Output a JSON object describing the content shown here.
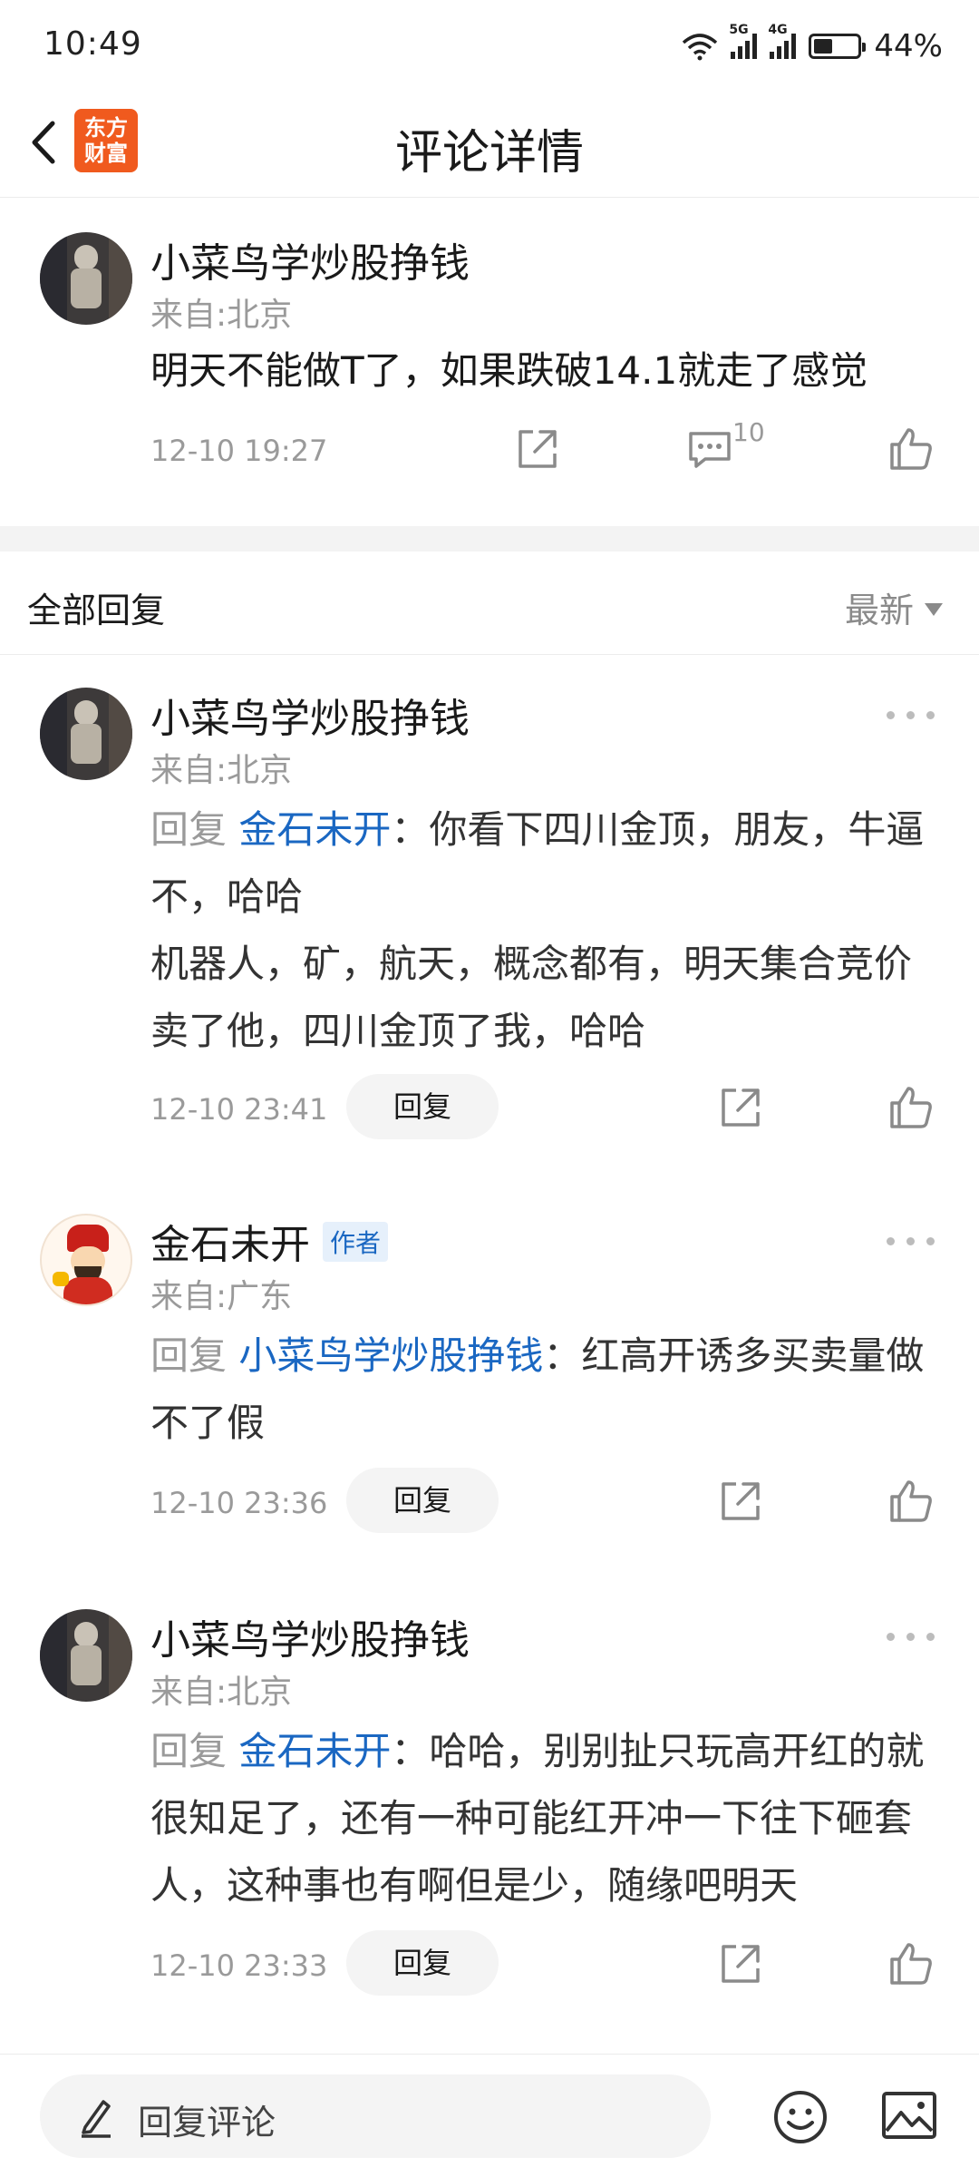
{
  "status_bar": {
    "time": "10:49",
    "network_1": "5G",
    "network_2": "4G",
    "battery": "44%"
  },
  "nav": {
    "title": "评论详情",
    "logo_line1": "东方",
    "logo_line2": "财富"
  },
  "main_comment": {
    "username": "小菜鸟学炒股挣钱",
    "location": "来自:北京",
    "content": "明天不能做T了，如果跌破14.1就走了感觉",
    "timestamp": "12-10 19:27",
    "reply_count": "10"
  },
  "replies_header": {
    "title": "全部回复",
    "sort": "最新"
  },
  "replies": [
    {
      "username": "小菜鸟学炒股挣钱",
      "location": "来自:北京",
      "prefix": "回复 ",
      "target": "金石未开",
      "separator": "：",
      "text": "你看下四川金顶，朋友，牛逼不，哈哈",
      "text2": "机器人，矿，航天，概念都有，明天集合竞价卖了他，四川金顶了我，哈哈",
      "timestamp": "12-10 23:41",
      "reply_label": "回复"
    },
    {
      "username": "金石未开",
      "badge": "作者",
      "location": "来自:广东",
      "prefix": "回复 ",
      "target": "小菜鸟学炒股挣钱",
      "separator": "：",
      "text": "红高开诱多买卖量做不了假",
      "timestamp": "12-10 23:36",
      "reply_label": "回复"
    },
    {
      "username": "小菜鸟学炒股挣钱",
      "location": "来自:北京",
      "prefix": "回复 ",
      "target": "金石未开",
      "separator": "：",
      "text": "哈哈，别别扯只玩高开红的就很知足了，还有一种可能红开冲一下往下砸套人，这种事也有啊但是少，随缘吧明天",
      "timestamp": "12-10 23:33",
      "reply_label": "回复"
    }
  ],
  "bottom_bar": {
    "placeholder": "回复评论"
  }
}
